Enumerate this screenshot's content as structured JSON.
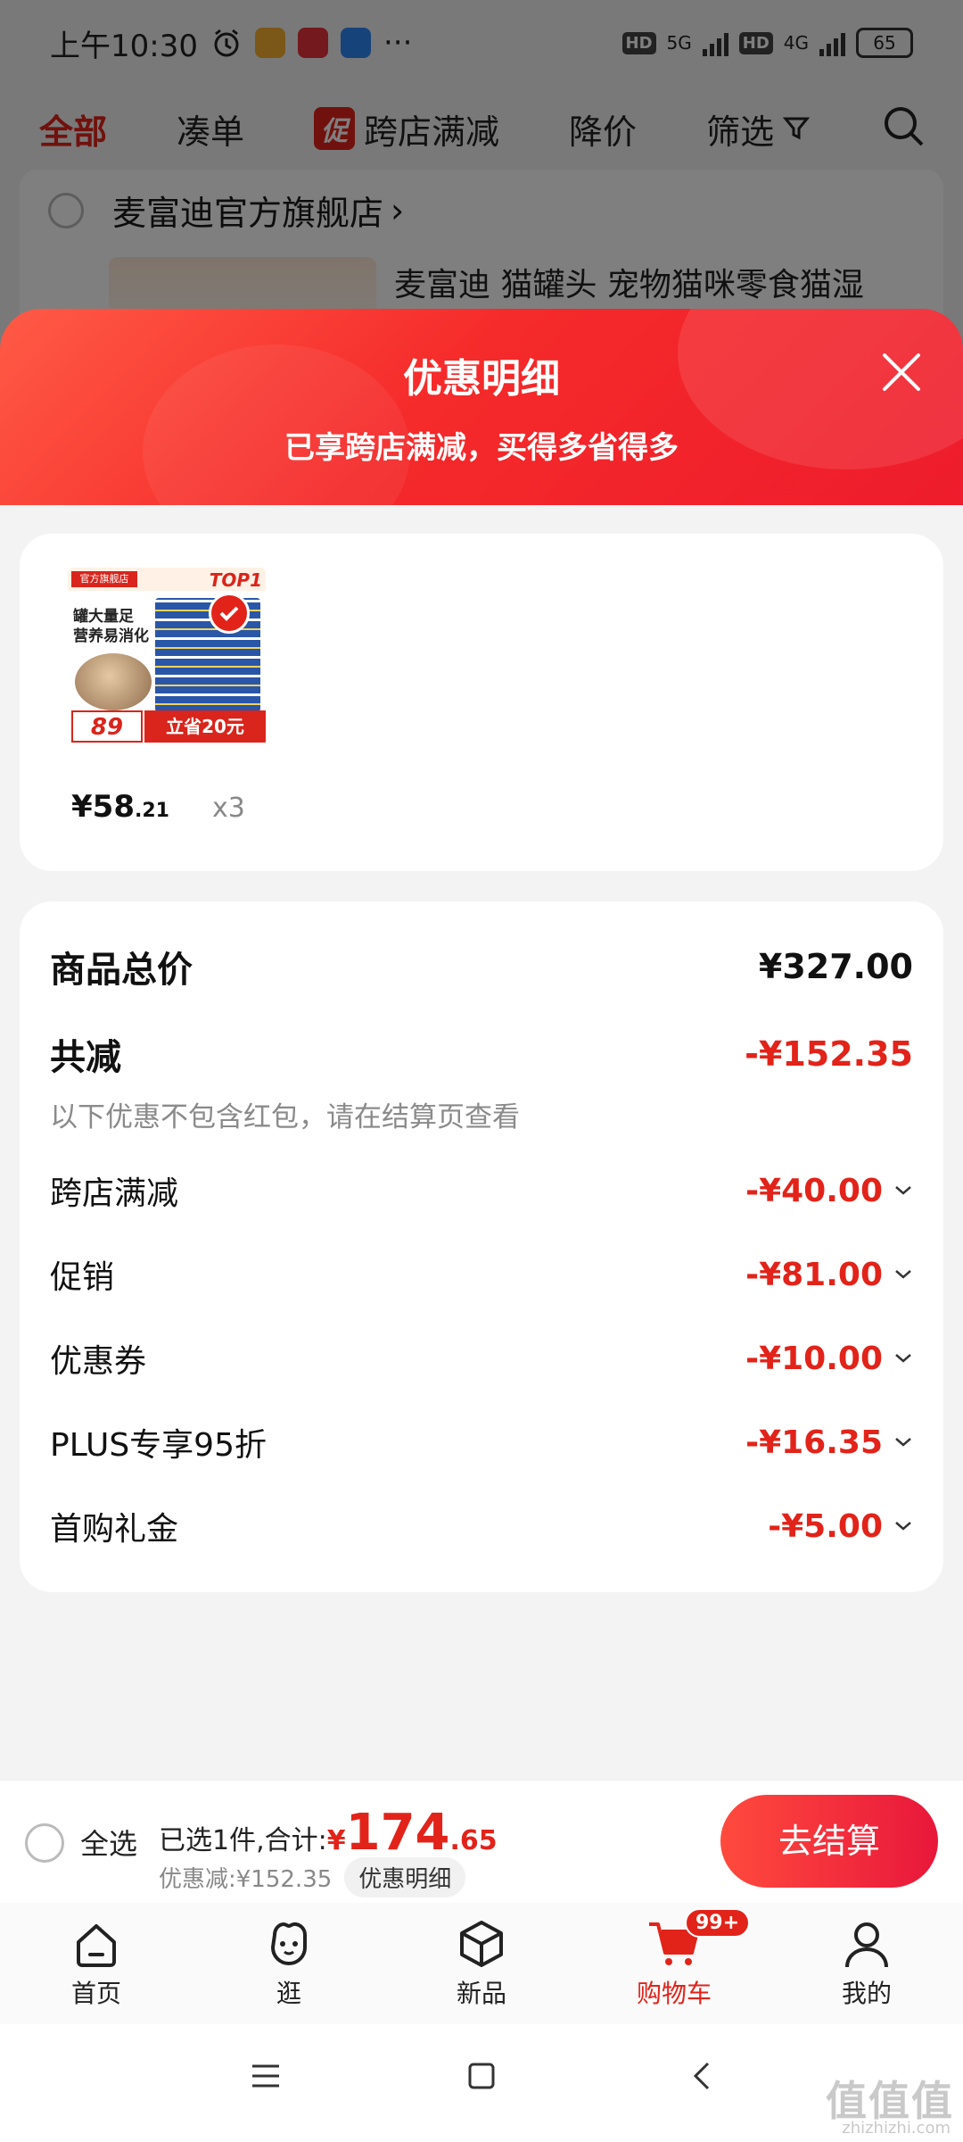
{
  "status_bar": {
    "time": "上午10:30",
    "more": "···",
    "net1": "5G",
    "net2": "4G",
    "hd": "HD",
    "battery": "65"
  },
  "top_tabs": [
    {
      "label": "全部",
      "active": true
    },
    {
      "label": "凑单"
    },
    {
      "label": "跨店满减",
      "tag": "促"
    },
    {
      "label": "降价"
    },
    {
      "label": "筛选"
    }
  ],
  "store": {
    "name": "麦富迪官方旗舰店",
    "product_title": "麦富迪 猫罐头 宠物猫咪零食猫湿"
  },
  "sheet": {
    "title": "优惠明细",
    "subtitle": "已享跨店满减，买得多省得多"
  },
  "product": {
    "image_texts": {
      "flag": "官方旗舰店",
      "rank": "TOP1",
      "tagline": "罐大量足 营养易消化",
      "price_badge": "89",
      "save_badge": "立省20元"
    },
    "price_int": "¥58",
    "price_dec": ".21",
    "qty": "x3"
  },
  "summary": {
    "total_label": "商品总价",
    "total_value": "¥327.00",
    "reduce_label": "共减",
    "reduce_value": "-¥152.35",
    "note": "以下优惠不包含红包，请在结算页查看",
    "items": [
      {
        "label": "跨店满减",
        "value": "-¥40.00"
      },
      {
        "label": "促销",
        "value": "-¥81.00"
      },
      {
        "label": "优惠券",
        "value": "-¥10.00"
      },
      {
        "label": "PLUS专享95折",
        "value": "-¥16.35"
      },
      {
        "label": "首购礼金",
        "value": "-¥5.00"
      }
    ]
  },
  "checkout": {
    "select_all": "全选",
    "selected_text": "已选1件,合计:",
    "total_symbol": "¥",
    "total_int": "174",
    "total_dec": ".65",
    "discount_text": "优惠减:¥152.35",
    "detail_link": "优惠明细",
    "checkout_button": "去结算"
  },
  "bottom_nav": [
    {
      "label": "首页",
      "icon": "home-icon"
    },
    {
      "label": "逛",
      "icon": "face-icon"
    },
    {
      "label": "新品",
      "icon": "cube-icon"
    },
    {
      "label": "购物车",
      "icon": "cart-icon",
      "active": true,
      "badge": "99+"
    },
    {
      "label": "我的",
      "icon": "user-icon"
    }
  ],
  "watermark": {
    "text": "值值值",
    "sub": "zhizhizhi.com"
  },
  "colors": {
    "accent": "#e2231a",
    "header_red": "#f52a2a"
  }
}
